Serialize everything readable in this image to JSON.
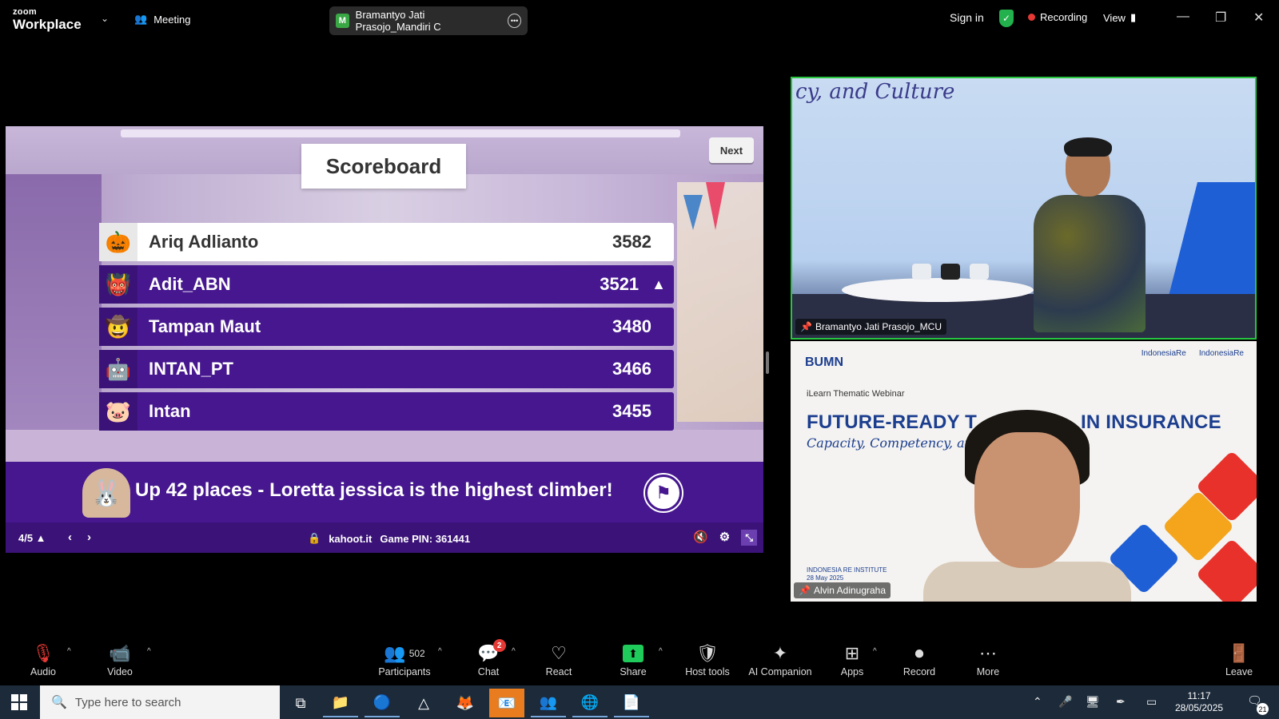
{
  "titlebar": {
    "brand_small": "zoom",
    "brand_large": "Workplace",
    "meeting_label": "Meeting",
    "tab_badge": "M",
    "tab_title": "Bramantyo Jati Prasojo_Mandiri C",
    "sign_in": "Sign in",
    "recording": "Recording",
    "view": "View",
    "colors": {
      "shield": "#22b14c",
      "recording_dot": "#e53935"
    }
  },
  "kahoot": {
    "title": "Scoreboard",
    "next": "Next",
    "rows": [
      {
        "name": "Ariq Adlianto",
        "score": "3582",
        "avatar": "🎃"
      },
      {
        "name": "Adit_ABN",
        "score": "3521",
        "avatar": "👹",
        "arrow": "▲"
      },
      {
        "name": "Tampan Maut",
        "score": "3480",
        "avatar": "🤠"
      },
      {
        "name": "INTAN_PT",
        "score": "3466",
        "avatar": "🤖"
      },
      {
        "name": "Intan",
        "score": "3455",
        "avatar": "🐷"
      }
    ],
    "climber_pre": "Up ",
    "climber_num": "42",
    "climber_post": " places - Loretta jessica is the highest climber!",
    "page": "4/5 ▲",
    "site": "kahoot.it",
    "pin": "Game PIN: 361441",
    "colors": {
      "purple": "#46178f",
      "dark_purple": "#3b1378"
    }
  },
  "videos": {
    "v1_name": "Bramantyo Jati Prasojo_MCU",
    "v1_backdrop_text": "cy, and Culture",
    "v2_name": "Alvin Adinugraha",
    "v2_logo_left": "BUMN",
    "v2_logo_right_1": "IndonesiaRe",
    "v2_logo_right_2": "IndonesiaRe",
    "v2_subtitle": "iLearn Thematic Webinar",
    "v2_title": "FUTURE-READY T",
    "v2_title_end": "IN INSURANCE",
    "v2_script": "Capacity, Competency, and Cu",
    "v2_foot_1": "INDONESIA RE INSTITUTE",
    "v2_foot_2": "28 May 2025"
  },
  "toolbar": {
    "audio": "Audio",
    "video": "Video",
    "participants": "Participants",
    "participants_count": "502",
    "chat": "Chat",
    "chat_badge": "2",
    "react": "React",
    "share": "Share",
    "host_tools": "Host tools",
    "ai_companion": "AI Companion",
    "apps": "Apps",
    "record": "Record",
    "more": "More",
    "leave": "Leave"
  },
  "taskbar": {
    "search_placeholder": "Type here to search",
    "time": "11:17",
    "date": "28/05/2025",
    "notif_count": "21"
  }
}
